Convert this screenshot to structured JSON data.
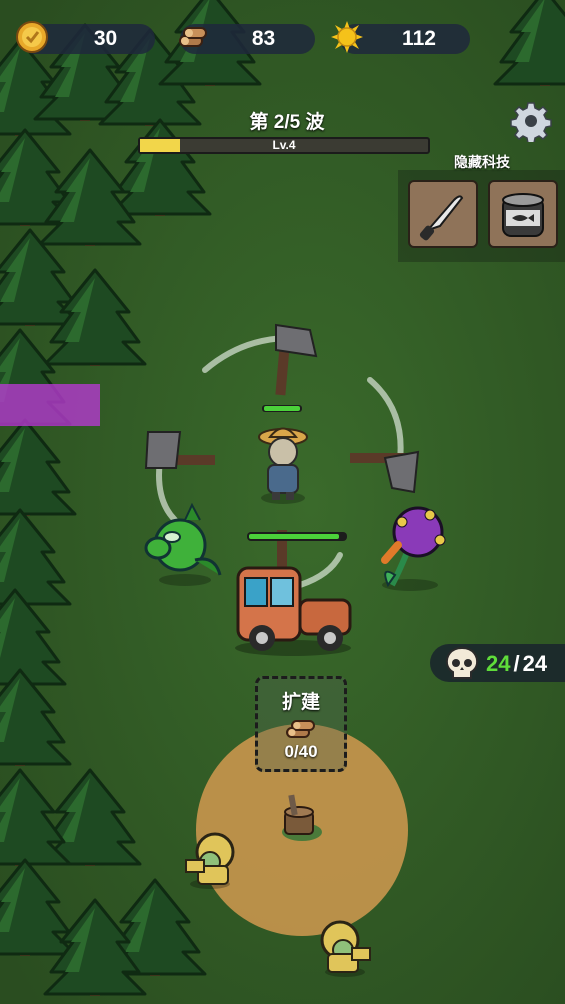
{
  "hud": {
    "gold": "30",
    "wood": "83",
    "energy": "112"
  },
  "wave": {
    "title": "第 2/5 波",
    "level_label": "Lv.4",
    "progress_fraction": 0.14
  },
  "tech": {
    "title": "隐藏科技",
    "items": [
      {
        "icon": "knife-icon"
      },
      {
        "icon": "canned-fish-icon"
      }
    ]
  },
  "kills": {
    "current": "24",
    "separator": "/",
    "total": "24"
  },
  "build": {
    "label": "扩建",
    "cost_progress": "0/40"
  },
  "colors": {
    "grass": "#2f5a24",
    "progress_fill": "#f2d64a",
    "kill_current": "#5fdc3a",
    "build_zone": "#c9964e"
  }
}
